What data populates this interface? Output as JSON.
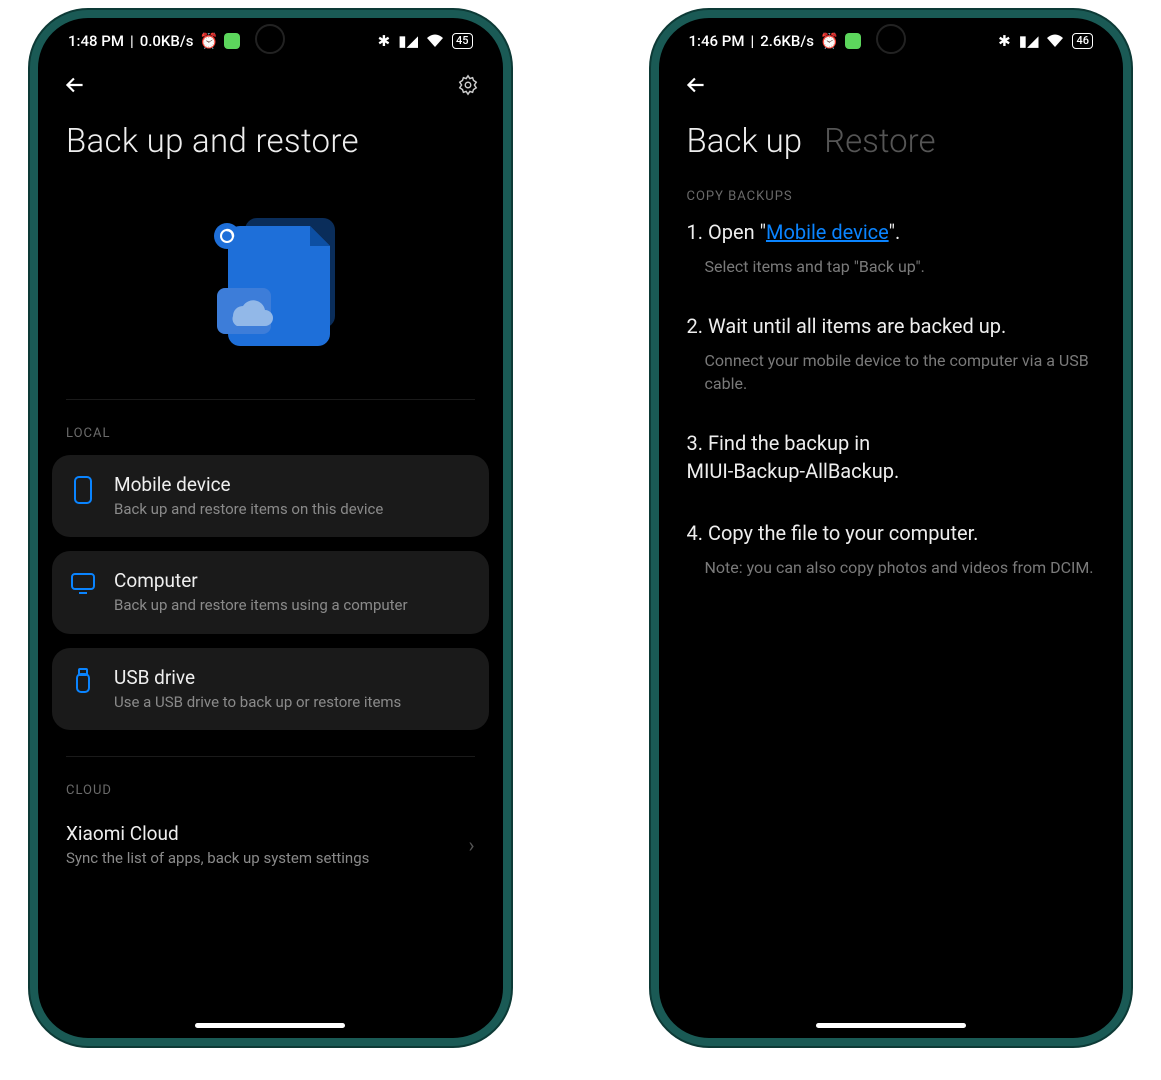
{
  "phone1": {
    "status": {
      "time": "1:48 PM",
      "net": "0.0KB/s",
      "battery": "45"
    },
    "title": "Back up and restore",
    "section_local": "LOCAL",
    "section_cloud": "CLOUD",
    "cards": [
      {
        "title": "Mobile device",
        "sub": "Back up and restore items on this device"
      },
      {
        "title": "Computer",
        "sub": "Back up and restore items using a computer"
      },
      {
        "title": "USB drive",
        "sub": "Use a USB drive to back up or restore items"
      }
    ],
    "cloud": {
      "title": "Xiaomi Cloud",
      "sub": "Sync the list of apps, back up system settings"
    }
  },
  "phone2": {
    "status": {
      "time": "1:46 PM",
      "net": "2.6KB/s",
      "battery": "46"
    },
    "tabs": {
      "active": "Back up",
      "inactive": "Restore"
    },
    "section": "COPY BACKUPS",
    "steps": [
      {
        "prefix": "1. Open \"",
        "link": "Mobile device",
        "suffix": "\".",
        "sub": "Select items and tap \"Back up\"."
      },
      {
        "line": "2. Wait until all items are backed up.",
        "sub": "Connect your mobile device to the computer via a USB cable."
      },
      {
        "line": "3. Find the backup in\nMIUI-Backup-AllBackup."
      },
      {
        "line": "4. Copy the file to your computer.",
        "sub": "Note: you can also copy photos and videos from DCIM."
      }
    ]
  }
}
